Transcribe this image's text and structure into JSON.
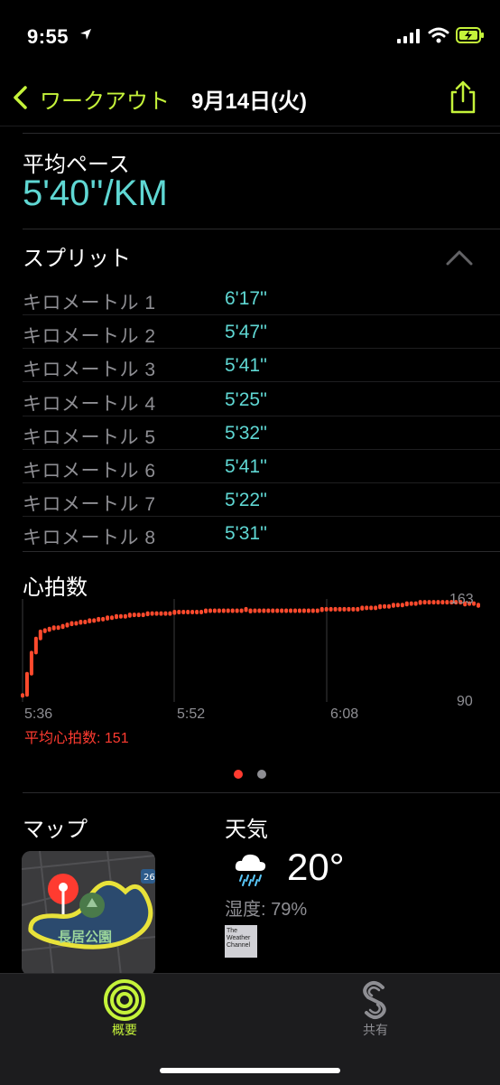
{
  "status_bar": {
    "time": "9:55"
  },
  "nav": {
    "back_label": "ワークアウト",
    "title": "9月14日(火)"
  },
  "avg_pace": {
    "label": "平均ペース",
    "value": "5'40''/KM"
  },
  "splits": {
    "title": "スプリット",
    "rows": [
      {
        "label": "キロメートル 1",
        "value": "6'17''"
      },
      {
        "label": "キロメートル 2",
        "value": "5'47''"
      },
      {
        "label": "キロメートル 3",
        "value": "5'41''"
      },
      {
        "label": "キロメートル 4",
        "value": "5'25''"
      },
      {
        "label": "キロメートル 5",
        "value": "5'32''"
      },
      {
        "label": "キロメートル 6",
        "value": "5'41''"
      },
      {
        "label": "キロメートル 7",
        "value": "5'22''"
      },
      {
        "label": "キロメートル 8",
        "value": "5'31''"
      }
    ]
  },
  "heart_rate": {
    "title": "心拍数",
    "average_label": "平均心拍数: 151",
    "colors": {
      "series": "#ff4a2d",
      "average": "#ff3b30"
    }
  },
  "chart_data": {
    "type": "scatter",
    "title": "心拍数",
    "x_ticks": [
      "5:36",
      "5:52",
      "6:08"
    ],
    "y_ticks": [
      "163",
      "90"
    ],
    "ylim": [
      90,
      163
    ],
    "values": [
      95,
      110,
      125,
      135,
      140,
      141,
      142,
      143,
      143,
      144,
      145,
      146,
      146,
      147,
      147,
      148,
      148,
      149,
      149,
      150,
      150,
      151,
      151,
      151,
      152,
      152,
      152,
      152,
      153,
      153,
      153,
      153,
      153,
      153,
      154,
      154,
      154,
      154,
      154,
      154,
      154,
      155,
      155,
      155,
      155,
      155,
      155,
      155,
      155,
      155,
      156,
      155,
      155,
      155,
      155,
      155,
      155,
      155,
      155,
      155,
      155,
      155,
      155,
      155,
      155,
      155,
      155,
      156,
      156,
      156,
      156,
      156,
      156,
      156,
      156,
      156,
      157,
      157,
      157,
      157,
      158,
      158,
      158,
      159,
      159,
      159,
      160,
      160,
      160,
      161,
      161,
      161,
      161,
      161,
      161,
      161,
      161,
      161,
      161,
      160,
      160,
      160,
      159
    ]
  },
  "pager": {
    "pages": 2,
    "active": 0,
    "colors": {
      "active": "#ff3b30",
      "inactive": "#8e8e93"
    }
  },
  "map": {
    "title": "マップ",
    "park_label": "長居公園",
    "route_badge": "26"
  },
  "weather": {
    "title": "天気",
    "temperature": "20°",
    "humidity": "湿度: 79%",
    "logo_text": "The Weather Channel",
    "icon": "rain-cloud-icon"
  },
  "tabs": [
    {
      "label": "概要",
      "icon": "activity-rings-icon",
      "active": true
    },
    {
      "label": "共有",
      "icon": "sharing-icon",
      "active": false
    }
  ],
  "colors": {
    "accent": "#c5f33a",
    "pace": "#5fd7d3",
    "background": "#000000"
  }
}
